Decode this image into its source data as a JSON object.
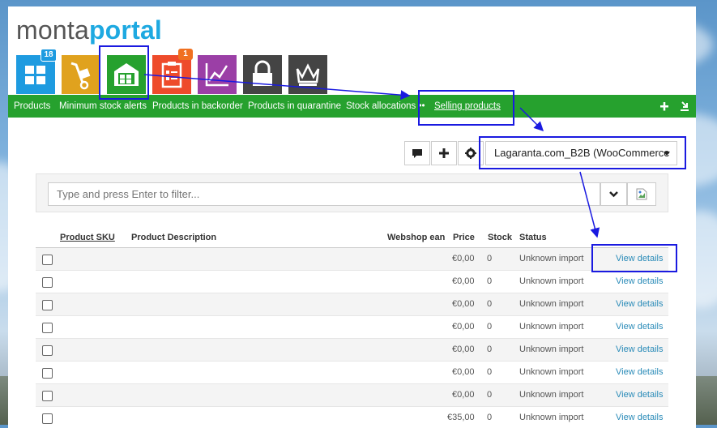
{
  "logo": {
    "part1": "monta",
    "part2": "portal"
  },
  "tiles": [
    {
      "name": "dashboard-tile",
      "color": "#1e9be0",
      "badge": "18",
      "badge_color": "#1e9be0"
    },
    {
      "name": "shipments-tile",
      "color": "#e0a21e"
    },
    {
      "name": "warehouse-tile",
      "color": "#26a12e"
    },
    {
      "name": "orders-tile",
      "color": "#ee4b2b",
      "badge": "1",
      "badge_color": "#f07020"
    },
    {
      "name": "reports-tile",
      "color": "#9b3fa6"
    },
    {
      "name": "lock-tile",
      "color": "#444444"
    },
    {
      "name": "premium-tile",
      "color": "#444444"
    }
  ],
  "nav": {
    "items": [
      "Products",
      "Minimum stock alerts",
      "Products in backorder",
      "Products in quarantine",
      "Stock allocations",
      "Selling products"
    ],
    "active": "Selling products",
    "right_icons": [
      "plus-icon",
      "download-icon"
    ],
    "color": "#26a12e"
  },
  "toolbar": {
    "buttons": [
      "comment-icon",
      "plus-icon",
      "gear-icon"
    ],
    "shop_select": "Lagaranta.com_B2B (WooCommerce"
  },
  "filter": {
    "placeholder": "Type and press Enter to filter..."
  },
  "table": {
    "headers": [
      "Product SKU",
      "Product Description",
      "Webshop ean",
      "Price",
      "Stock",
      "Status"
    ],
    "rows": [
      {
        "price": "€0,00",
        "stock": "0",
        "status": "Unknown import",
        "action": "View details"
      },
      {
        "price": "€0,00",
        "stock": "0",
        "status": "Unknown import",
        "action": "View details"
      },
      {
        "price": "€0,00",
        "stock": "0",
        "status": "Unknown import",
        "action": "View details"
      },
      {
        "price": "€0,00",
        "stock": "0",
        "status": "Unknown import",
        "action": "View details"
      },
      {
        "price": "€0,00",
        "stock": "0",
        "status": "Unknown import",
        "action": "View details"
      },
      {
        "price": "€0,00",
        "stock": "0",
        "status": "Unknown import",
        "action": "View details"
      },
      {
        "price": "€0,00",
        "stock": "0",
        "status": "Unknown import",
        "action": "View details"
      },
      {
        "price": "€35,00",
        "stock": "0",
        "status": "Unknown import",
        "action": "View details"
      }
    ]
  },
  "annotation_color": "#1a1ae0"
}
